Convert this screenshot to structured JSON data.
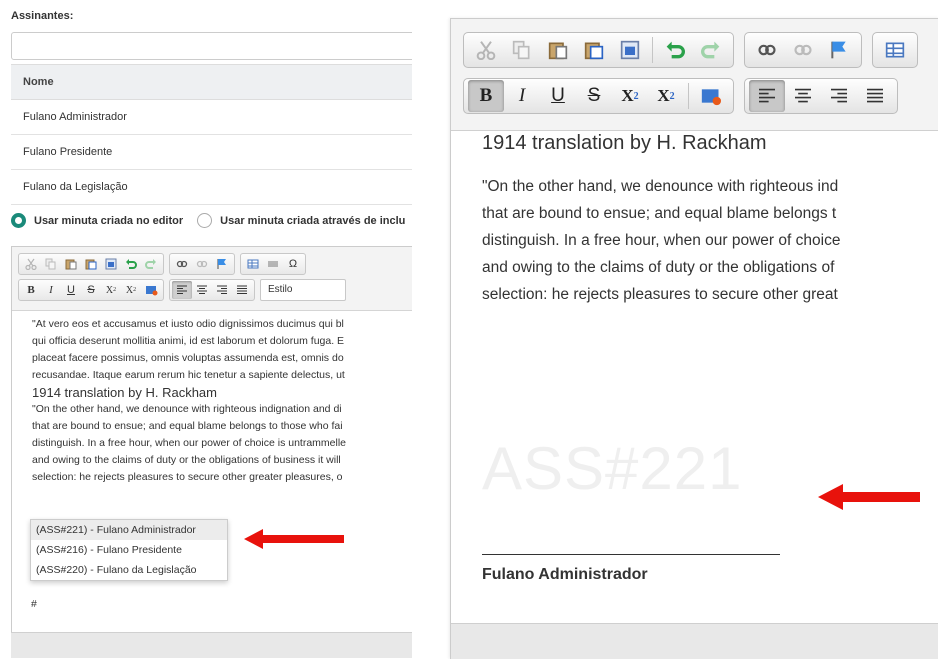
{
  "left": {
    "signers_label": "Assinantes:",
    "table": {
      "header": "Nome",
      "rows": [
        "Fulano Administrador",
        "Fulano Presidente",
        "Fulano da Legislação"
      ]
    },
    "radio_option_1": "Usar minuta criada no editor",
    "radio_option_2": "Usar minuta criada através de inclu",
    "toolbar": {
      "style_select": "Estilo"
    },
    "editor": {
      "paragraph_1": [
        "\"At vero eos et accusamus et iusto odio dignissimos ducimus qui bl",
        "qui officia deserunt mollitia animi, id est laborum et dolorum fuga. E",
        "placeat facere possimus, omnis voluptas assumenda est, omnis do",
        "recusandae. Itaque earum rerum hic tenetur a sapiente delectus, ut"
      ],
      "heading": "1914 translation by H. Rackham",
      "paragraph_2": [
        "\"On the other hand, we denounce with righteous indignation and di",
        "that are bound to ensue; and equal blame belongs to those who fai",
        "distinguish. In a free hour, when our power of choice is untrammelle",
        "and owing to the claims of duty or the obligations of business it will",
        "selection: he rejects pleasures to secure other greater pleasures, o"
      ],
      "cursor_text": "#"
    },
    "autocomplete": [
      "(ASS#221) - Fulano Administrador",
      "(ASS#216) - Fulano Presidente",
      "(ASS#220) - Fulano da Legislação"
    ]
  },
  "right": {
    "heading": "1914 translation by H. Rackham",
    "paragraph": [
      "\"On the other hand, we denounce with righteous ind",
      "that are bound to ensue; and equal blame belongs t",
      "distinguish. In a free hour, when our power of choice",
      "and owing to the claims of duty or the obligations of",
      "selection: he rejects pleasures to secure other great"
    ],
    "watermark": "ASS#221",
    "signature_name": "Fulano Administrador"
  },
  "colors": {
    "accent": "#1a8a7a",
    "arrow": "#e8120c"
  }
}
